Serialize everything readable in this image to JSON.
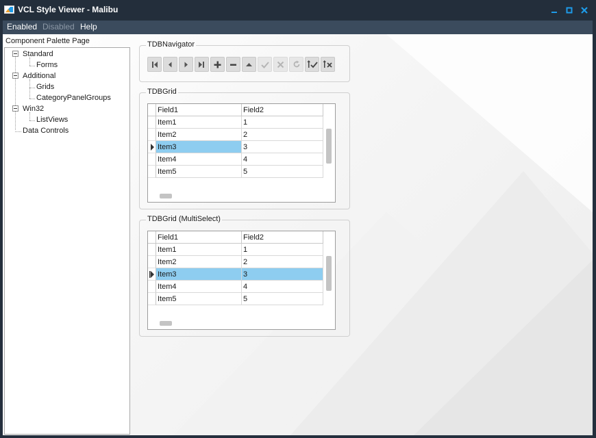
{
  "window": {
    "title": "VCL Style Viewer - Malibu",
    "accent": "#1e9be8",
    "titlebar_bg": "#232e3b"
  },
  "menubar": {
    "items": [
      "Enabled",
      "Disabled",
      "Help"
    ]
  },
  "palette": {
    "label": "Component Palette Page",
    "tree": [
      {
        "label": "Standard",
        "children": [
          "Forms"
        ]
      },
      {
        "label": "Additional",
        "children": [
          "Grids",
          "CategoryPanelGroups"
        ]
      },
      {
        "label": "Win32",
        "children": [
          "ListViews"
        ]
      },
      {
        "label": "Data Controls",
        "children": []
      }
    ]
  },
  "navigator": {
    "caption": "TDBNavigator",
    "buttons": [
      {
        "icon": "first-record-icon",
        "enabled": true
      },
      {
        "icon": "prior-record-icon",
        "enabled": true
      },
      {
        "icon": "next-record-icon",
        "enabled": true
      },
      {
        "icon": "last-record-icon",
        "enabled": true
      },
      {
        "icon": "insert-record-icon",
        "enabled": true
      },
      {
        "icon": "delete-record-icon",
        "enabled": true
      },
      {
        "icon": "edit-record-icon",
        "enabled": true
      },
      {
        "icon": "post-record-icon",
        "enabled": false
      },
      {
        "icon": "cancel-record-icon",
        "enabled": false
      },
      {
        "icon": "refresh-record-icon",
        "enabled": false
      },
      {
        "icon": "apply-updates-icon",
        "enabled": true
      },
      {
        "icon": "cancel-updates-icon",
        "enabled": true
      }
    ]
  },
  "grid1": {
    "caption": "TDBGrid",
    "columns": [
      "Field1",
      "Field2"
    ],
    "rows": [
      [
        "Item1",
        "1"
      ],
      [
        "Item2",
        "2"
      ],
      [
        "Item3",
        "3"
      ],
      [
        "Item4",
        "4"
      ],
      [
        "Item5",
        "5"
      ]
    ],
    "selected_row": 2
  },
  "grid2": {
    "caption": "TDBGrid (MultiSelect)",
    "columns": [
      "Field1",
      "Field2"
    ],
    "rows": [
      [
        "Item1",
        "1"
      ],
      [
        "Item2",
        "2"
      ],
      [
        "Item3",
        "3"
      ],
      [
        "Item4",
        "4"
      ],
      [
        "Item5",
        "5"
      ]
    ],
    "selected_row": 2
  }
}
